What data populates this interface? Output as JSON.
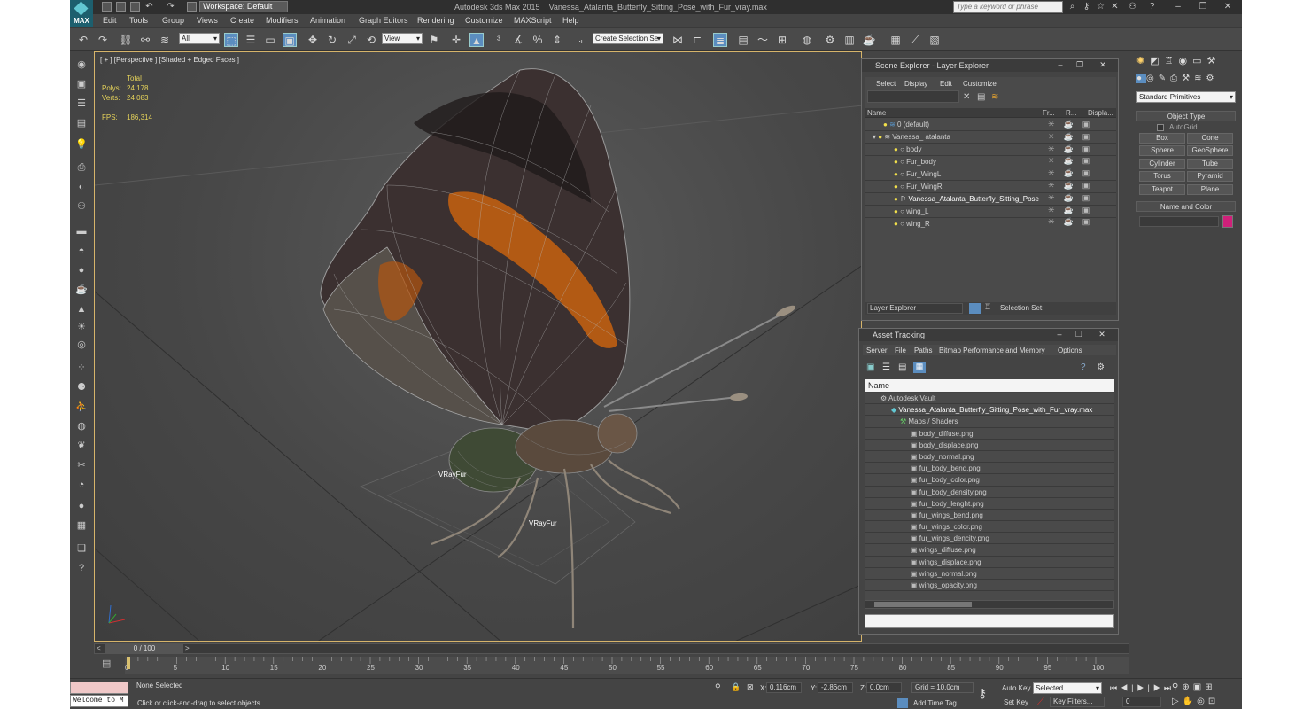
{
  "app": {
    "title": "Autodesk 3ds Max 2015",
    "file": "Vanessa_Atalanta_Butterfly_Sitting_Pose_with_Fur_vray.max",
    "logo": "MAX",
    "workspace": "Workspace: Default",
    "search_placeholder": "Type a keyword or phrase"
  },
  "menus": [
    "Edit",
    "Tools",
    "Group",
    "Views",
    "Create",
    "Modifiers",
    "Animation",
    "Graph Editors",
    "Rendering",
    "Customize",
    "MAXScript",
    "Help"
  ],
  "toolbar": {
    "filter": "All",
    "view": "View",
    "selection_set": "Create Selection Se"
  },
  "viewport": {
    "label": "[ + ] [Perspective ] [Shaded + Edged Faces ]",
    "total": "Total",
    "polys_label": "Polys:",
    "polys": "24 178",
    "verts_label": "Verts:",
    "verts": "24 083",
    "fps_label": "FPS:",
    "fps": "186,314",
    "vray1": "VRayFur",
    "vray2": "VRayFur"
  },
  "scene_explorer": {
    "title": "Scene Explorer - Layer Explorer",
    "menus": [
      "Select",
      "Display",
      "Edit",
      "Customize"
    ],
    "col_name": "Name",
    "col_fr": "Fr...",
    "col_r": "R...",
    "col_disp": "Displa...",
    "rows": [
      "0 (default)",
      "Vanessa_ atalanta",
      "body",
      "Fur_body",
      "Fur_WingL",
      "Fur_WingR",
      "Vanessa_Atalanta_Butterfly_Sitting_Pose",
      "wing_L",
      "wing_R"
    ],
    "footer_dropdown": "Layer Explorer",
    "selection_set": "Selection Set:"
  },
  "asset_tracking": {
    "title": "Asset Tracking",
    "menus": [
      "Server",
      "File",
      "Paths",
      "Bitmap Performance and Memory",
      "Options"
    ],
    "col_name": "Name",
    "vault": "Autodesk Vault",
    "file": "Vanessa_Atalanta_Butterfly_Sitting_Pose_with_Fur_vray.max",
    "maps": "Maps / Shaders",
    "files": [
      "body_diffuse.png",
      "body_displace.png",
      "body_normal.png",
      "fur_body_bend.png",
      "fur_body_color.png",
      "fur_body_density.png",
      "fur_body_lenght.png",
      "fur_wings_bend.png",
      "fur_wings_color.png",
      "fur_wings_dencity.png",
      "wings_diffuse.png",
      "wings_displace.png",
      "wings_normal.png",
      "wings_opacity.png"
    ]
  },
  "command_panel": {
    "dropdown": "Standard Primitives",
    "object_type": "Object Type",
    "autogrid": "AutoGrid",
    "buttons": [
      "Box",
      "Cone",
      "Sphere",
      "GeoSphere",
      "Cylinder",
      "Tube",
      "Torus",
      "Pyramid",
      "Teapot",
      "Plane"
    ],
    "name_color": "Name and Color",
    "swatch": "#d0207a"
  },
  "timeline": {
    "frame": "0 / 100",
    "ticks": [
      "0",
      "5",
      "10",
      "15",
      "20",
      "25",
      "30",
      "35",
      "40",
      "45",
      "50",
      "55",
      "60",
      "65",
      "70",
      "75",
      "80",
      "85",
      "90",
      "95",
      "100"
    ]
  },
  "status": {
    "welcome": "Welcome to M",
    "none_selected": "None Selected",
    "hint": "Click or click-and-drag to select objects",
    "x_label": "X:",
    "x": "0,116cm",
    "y_label": "Y:",
    "y": "-2,86cm",
    "z_label": "Z:",
    "z": "0,0cm",
    "grid": "Grid = 10,0cm",
    "add_time_tag": "Add Time Tag",
    "auto_key": "Auto Key",
    "selected": "Selected",
    "set_key": "Set Key",
    "key_filters": "Key Filters...",
    "frame": "0"
  }
}
